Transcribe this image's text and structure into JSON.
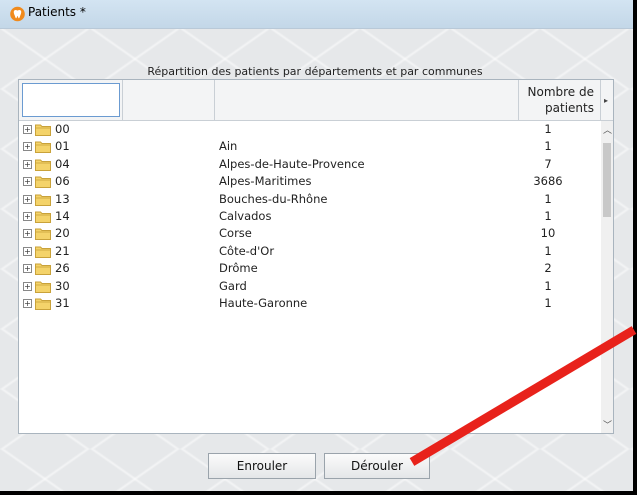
{
  "window": {
    "title": "Patients *"
  },
  "table": {
    "caption": "Répartition des patients par départements et par communes",
    "header_count": "Nombre de patients",
    "rows": [
      {
        "code": "00",
        "name": "",
        "count": "1"
      },
      {
        "code": "01",
        "name": "Ain",
        "count": "1"
      },
      {
        "code": "04",
        "name": "Alpes-de-Haute-Provence",
        "count": "7"
      },
      {
        "code": "06",
        "name": "Alpes-Maritimes",
        "count": "3686"
      },
      {
        "code": "13",
        "name": "Bouches-du-Rhône",
        "count": "1"
      },
      {
        "code": "14",
        "name": "Calvados",
        "count": "1"
      },
      {
        "code": "20",
        "name": "Corse",
        "count": "10"
      },
      {
        "code": "21",
        "name": "Côte-d'Or",
        "count": "1"
      },
      {
        "code": "26",
        "name": "Drôme",
        "count": "2"
      },
      {
        "code": "30",
        "name": "Gard",
        "count": "1"
      },
      {
        "code": "31",
        "name": "Haute-Garonne",
        "count": "1"
      }
    ]
  },
  "buttons": {
    "collapse": "Enrouler",
    "expand": "Dérouler"
  },
  "colors": {
    "annotation_arrow": "#e8221b",
    "folder": "#f4d36a",
    "app_icon": "#f08a1c"
  },
  "icons": {
    "app": "tooth-icon",
    "folder": "folder-icon",
    "expander": "plus-box-icon"
  }
}
